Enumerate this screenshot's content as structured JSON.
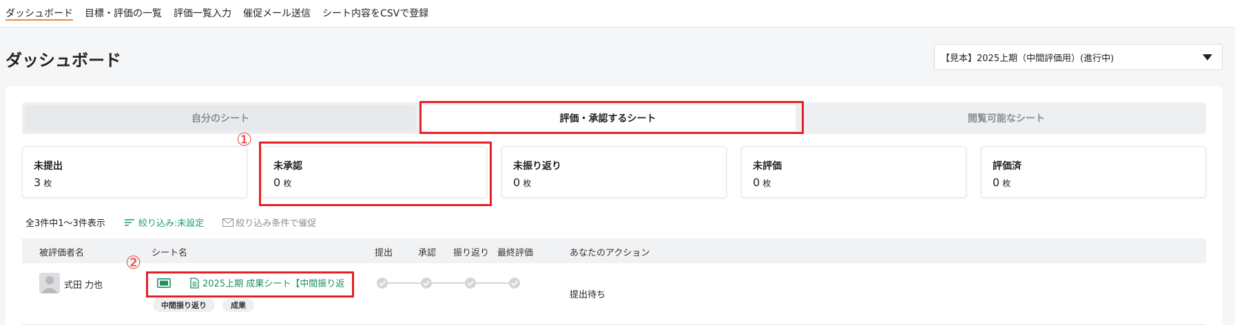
{
  "nav": {
    "items": [
      {
        "label": "ダッシュボード"
      },
      {
        "label": "目標・評価の一覧"
      },
      {
        "label": "評価一覧入力"
      },
      {
        "label": "催促メール送信"
      },
      {
        "label": "シート内容をCSVで登録"
      }
    ]
  },
  "page": {
    "title": "ダッシュボード",
    "period_select": "【見本】2025上期（中間評価用）(進行中)"
  },
  "tabs": [
    {
      "label": "自分のシート"
    },
    {
      "label": "評価・承認するシート"
    },
    {
      "label": "閲覧可能なシート"
    }
  ],
  "stats": [
    {
      "label": "未提出",
      "count": "3",
      "unit": "枚"
    },
    {
      "label": "未承認",
      "count": "0",
      "unit": "枚"
    },
    {
      "label": "未振り返り",
      "count": "0",
      "unit": "枚"
    },
    {
      "label": "未評価",
      "count": "0",
      "unit": "枚"
    },
    {
      "label": "評価済",
      "count": "0",
      "unit": "枚"
    }
  ],
  "summary": {
    "count_text": "全3件中1〜3件表示",
    "filter_text": "絞り込み:未設定",
    "remind_text": "絞り込み条件で催促"
  },
  "table": {
    "headers": {
      "person": "被評価者名",
      "sheet": "シート名",
      "submit": "提出",
      "approve": "承認",
      "review": "振り返り",
      "final": "最終評価",
      "action": "あなたのアクション"
    },
    "rows": [
      {
        "person": "式田 力也",
        "sheet_name": "2025上期 成果シート【中間振り返",
        "tags": [
          "中間振り返り",
          "成果"
        ],
        "action": "提出待ち"
      }
    ]
  },
  "annotations": {
    "marker1": "①",
    "marker2": "②"
  },
  "colors": {
    "accent_green": "#1e8e5c",
    "highlight_red": "#e61e26",
    "nav_active": "#e8873a"
  }
}
